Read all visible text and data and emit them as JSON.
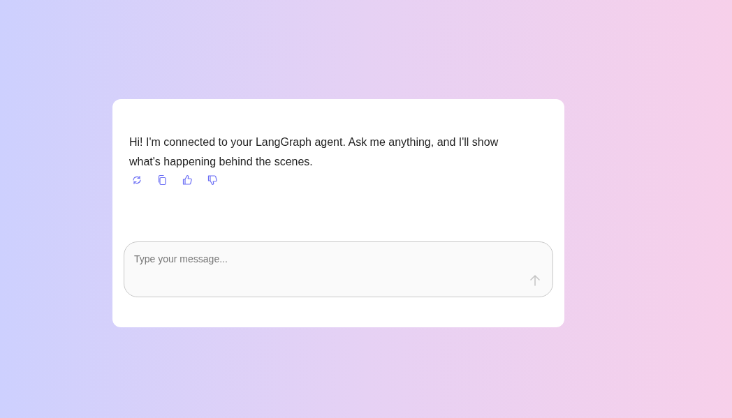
{
  "messages": [
    {
      "text": "Hi! I'm connected to your LangGraph agent. Ask me anything, and I'll show what's happening behind the scenes.",
      "actions": [
        {
          "kind": "regenerate"
        },
        {
          "kind": "copy"
        },
        {
          "kind": "thumbs_up"
        },
        {
          "kind": "thumbs_down"
        }
      ]
    }
  ],
  "composer": {
    "placeholder": "Type your message...",
    "send_disabled": true
  }
}
